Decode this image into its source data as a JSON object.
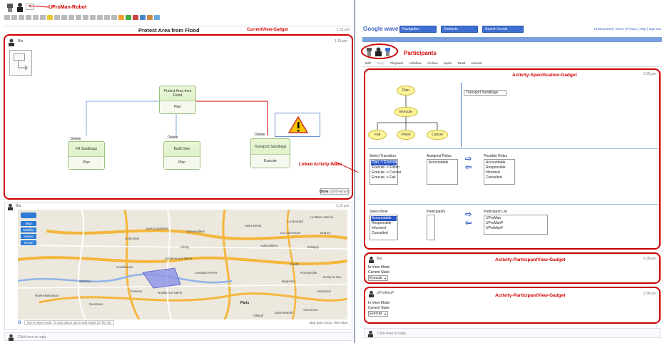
{
  "robot_label": "UProMan-Robot",
  "left": {
    "doc_title": "Protect Area from Flood",
    "view_gadget_label": "CurrentView-Gadget",
    "title_time": "1:11 pm",
    "wave_author": "Bla",
    "wave_time": "1:15 pm",
    "nodes": {
      "root": {
        "name": "Protect Area from Flood",
        "state": "Plan"
      },
      "fill": {
        "tag": "Delete",
        "name": "Fill Sandbags",
        "state": "Plan"
      },
      "build": {
        "tag": "Delete",
        "name": "Build Dam",
        "state": "Plan"
      },
      "transport": {
        "tag": "Delete",
        "name": "Transport Sandbags",
        "state": "Execute"
      }
    },
    "linked_label": "Linked Activity-Wave",
    "done_button": "Done",
    "done_hint": "[Shift+Enter]",
    "map_author": "Bla",
    "map_time": "1:15 pm",
    "map_buttons": [
      "Map",
      "Satellite",
      "Hybrid",
      "Terrain"
    ],
    "map_places": [
      "Colombes",
      "Courbevoie",
      "Clichy",
      "Nanterre",
      "Paris",
      "Saint-Denis",
      "Aubervilliers",
      "Pantin",
      "Montreuil",
      "Puteaux",
      "Rueil-Malmaison",
      "Suresnes",
      "Levallois-Perret",
      "Neuilly-sur-Seine",
      "Asnières-sur-Seine",
      "Gennevilliers",
      "La Courneuve",
      "Bobigny",
      "Drancy",
      "Le Blanc-Mesnil",
      "Vincennes",
      "Saint-Mandé",
      "Bagnolet",
      "Romainville",
      "Noisy-le-Sec",
      "Bois-Colombes",
      "Le Bourget",
      "Villejuif"
    ],
    "map_footer": "Not in view mode. To edit, place tap in edit mode (CTRL+E)",
    "map_copyright": "Map data ©2011 Tele Atlas",
    "reply_text": "Click here to reply"
  },
  "right": {
    "app_logo": "Google wave",
    "nav_buttons": [
      "Navigation",
      "Contacts",
      "Search 'is:ods"
    ],
    "top_links": "Unstructured | Terms | Privacy | Help | Sign out",
    "participants_label": "Participants",
    "toolbar": [
      "Edit",
      "Reply",
      "Playback",
      "Unfollow",
      "Archive",
      "Spam",
      "Read",
      "Unread"
    ],
    "activity_spec_label": "Activity-Specification-Gadget",
    "spec_time": "2:35 pm",
    "states": {
      "plan": "Plan",
      "execute": "Execute",
      "fail": "Fail",
      "finish": "Finish",
      "cancel": "Cancel"
    },
    "selected_activity": "Transport Sandbags",
    "select_transition_label": "Select Transition",
    "transitions": [
      "Plan -> Execute",
      "Execute -> Finish",
      "Execute -> Cancel",
      "Execute -> Fail"
    ],
    "assigned_roles_label": "Assigned Roles",
    "assigned_roles": [
      "Accountable"
    ],
    "possible_roles_label": "Possible Roles",
    "possible_roles": [
      "Accountable",
      "Responsible",
      "Informed",
      "Consulted"
    ],
    "select_role_label": "Select Role",
    "roles": [
      "Accountable",
      "Responsible",
      "Informed",
      "Consulted"
    ],
    "participants_list_label": "Participants",
    "participant_list_label": "Participant List",
    "participant_list": [
      "UProMan",
      "UProManP",
      "UProManF"
    ],
    "pv1": {
      "author": "Bla",
      "label": "Activity-ParticipantView-Gadget",
      "time": "2:38 pm",
      "mode": "In View Mode",
      "state_label": "Current State",
      "state_value": "Execute"
    },
    "pv2": {
      "author": "UProManP",
      "label": "Activity-ParticipantView-Gadget",
      "time": "2:38 pm",
      "mode": "In View Mode",
      "state_label": "Current State",
      "state_value": "Execute"
    },
    "reply_text": "Click here to reply"
  },
  "colors": {
    "annotation_red": "#d40000",
    "wave_blue": "#3d6fd0",
    "node_green": "#dcefc6",
    "state_yellow": "#fef59a"
  }
}
